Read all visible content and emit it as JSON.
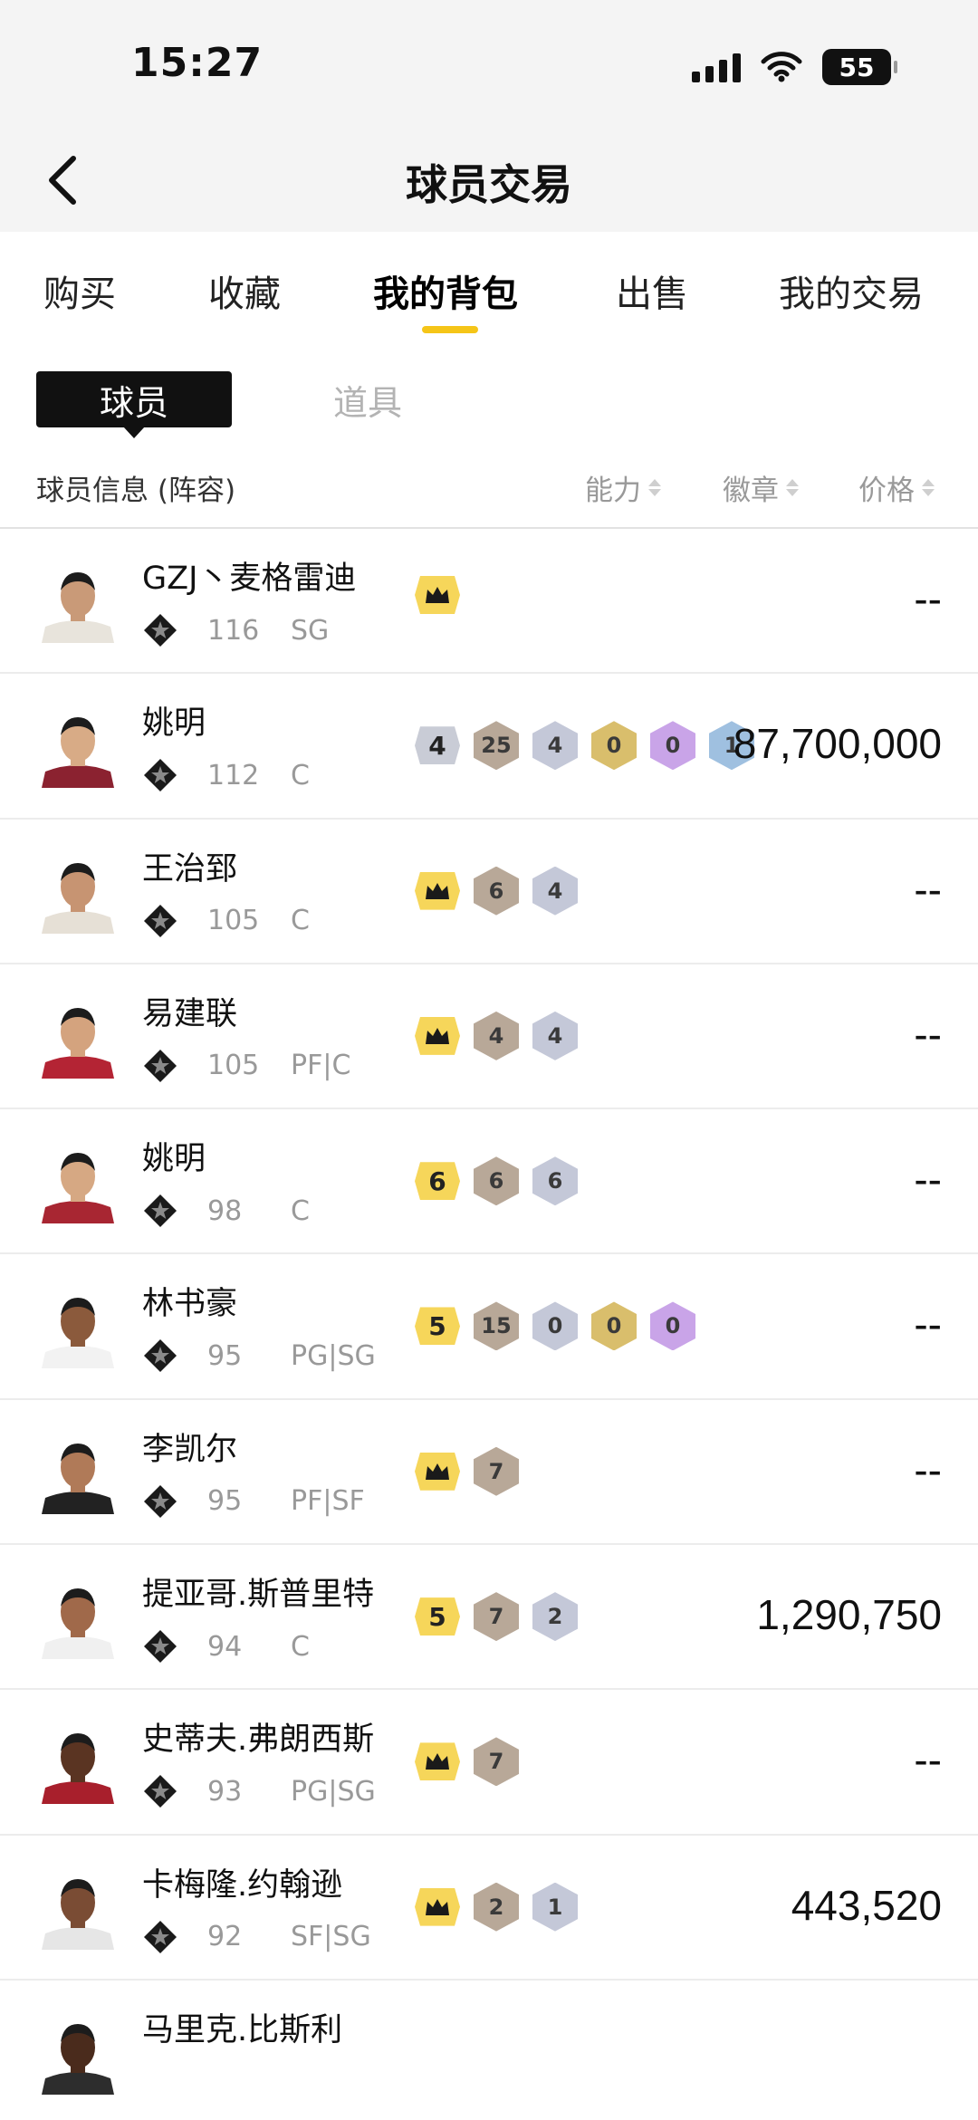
{
  "status": {
    "time": "15:27",
    "battery": "55"
  },
  "nav": {
    "title": "球员交易"
  },
  "tabs": [
    "购买",
    "收藏",
    "我的背包",
    "出售",
    "我的交易"
  ],
  "segments": {
    "active": "球员",
    "inactive": "道具"
  },
  "list_header": {
    "info": "球员信息 (阵容)",
    "ability": "能力",
    "badge": "徽章",
    "price": "价格"
  },
  "players": [
    {
      "name": "GZJ丶麦格雷迪",
      "ovr": "116",
      "pos": "SG",
      "level": "crown",
      "badges": [],
      "price": "--"
    },
    {
      "name": "姚明",
      "ovr": "112",
      "pos": "C",
      "level": "4",
      "badges": [
        "25",
        "4",
        "0",
        "0",
        "1"
      ],
      "price": "87,700,000"
    },
    {
      "name": "王治郅",
      "ovr": "105",
      "pos": "C",
      "level": "crown",
      "badges": [
        "6",
        "4"
      ],
      "price": "--"
    },
    {
      "name": "易建联",
      "ovr": "105",
      "pos": "PF|C",
      "level": "crown",
      "badges": [
        "4",
        "4"
      ],
      "price": "--"
    },
    {
      "name": "姚明",
      "ovr": "98",
      "pos": "C",
      "level": "6",
      "badges": [
        "6",
        "6"
      ],
      "price": "--"
    },
    {
      "name": "林书豪",
      "ovr": "95",
      "pos": "PG|SG",
      "level": "5",
      "badges": [
        "15",
        "0",
        "0",
        "0"
      ],
      "price": "--"
    },
    {
      "name": "李凯尔",
      "ovr": "95",
      "pos": "PF|SF",
      "level": "crown",
      "badges": [
        "7"
      ],
      "price": "--"
    },
    {
      "name": "提亚哥.斯普里特",
      "ovr": "94",
      "pos": "C",
      "level": "5",
      "badges": [
        "7",
        "2"
      ],
      "price": "1,290,750"
    },
    {
      "name": "史蒂夫.弗朗西斯",
      "ovr": "93",
      "pos": "PG|SG",
      "level": "crown",
      "badges": [
        "7"
      ],
      "price": "--"
    },
    {
      "name": "卡梅隆.约翰逊",
      "ovr": "92",
      "pos": "SF|SG",
      "level": "crown",
      "badges": [
        "2",
        "1"
      ],
      "price": "443,520"
    },
    {
      "name": "马里克.比斯利",
      "ovr": "",
      "pos": "",
      "level": "",
      "badges": [],
      "price": ""
    }
  ],
  "colors": {
    "accent": "#f5c518",
    "badge_bronze": "#b8a898",
    "badge_silver": "#c4c8d8",
    "badge_gold": "#d9be6c",
    "badge_purple": "#c9a4e8",
    "badge_blue": "#9fc0e0"
  }
}
